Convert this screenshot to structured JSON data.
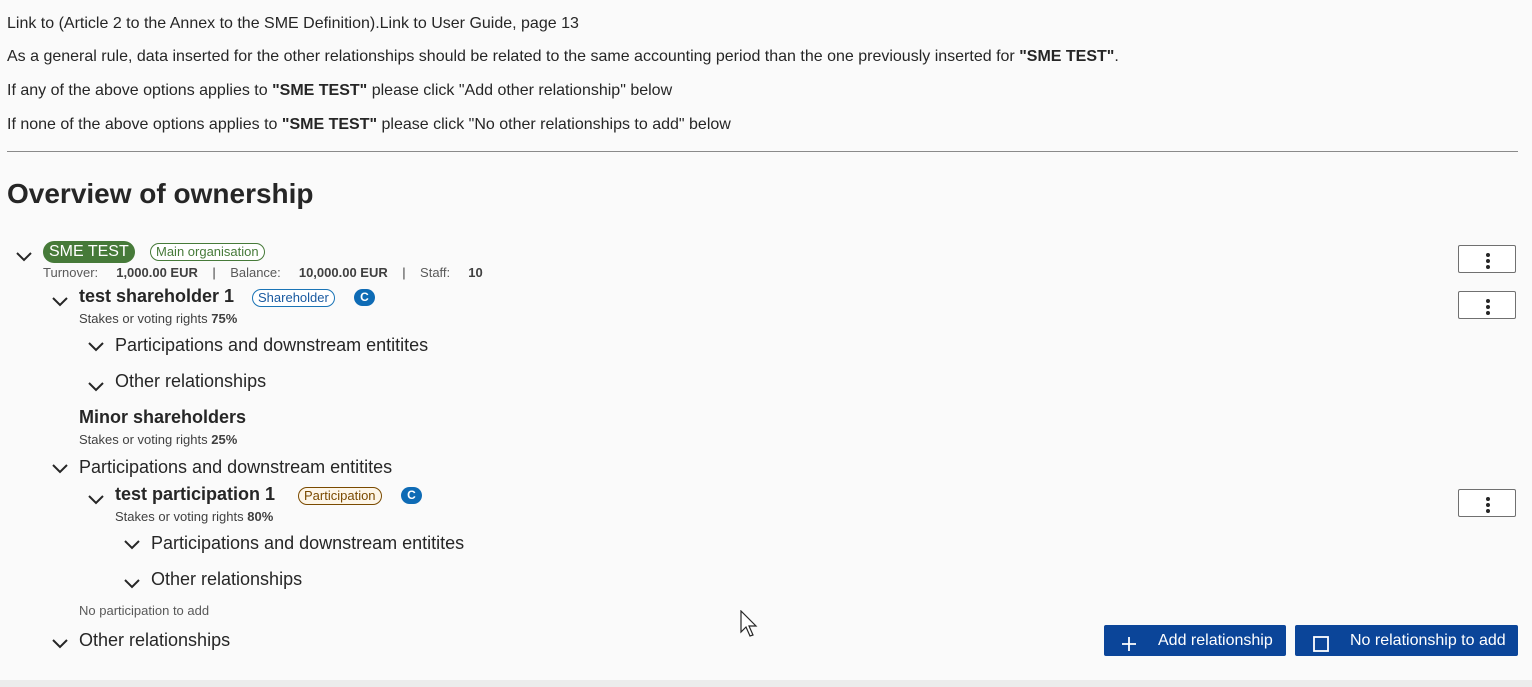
{
  "intro": {
    "line1": "Link to (Article 2 to the Annex to the SME Definition).Link to User Guide, page 13",
    "line2_pre": "As a general rule, data inserted for the other relationships should be related to the same accounting period than the one previously inserted for ",
    "line2_bold": "\"SME TEST\"",
    "line2_post": ".",
    "line3_pre": "If any of the above options applies to ",
    "line3_bold": "\"SME TEST\"",
    "line3_post": " please click \"Add other relationship\" below",
    "line4_pre": "If none of the above options applies to ",
    "line4_bold": "\"SME TEST\"",
    "line4_post": " please click \"No other relationships to add\" below"
  },
  "heading": "Overview of ownership",
  "main_org": {
    "name": "SME TEST",
    "badge": "Main organisation",
    "turnover_label": "Turnover:",
    "turnover_value": "1,000.00 EUR",
    "balance_label": "Balance:",
    "balance_value": "10,000.00 EUR",
    "staff_label": "Staff:",
    "staff_value": "10",
    "sep": "|"
  },
  "shareholder": {
    "name": "test shareholder 1",
    "badge": "Shareholder",
    "c_badge": "C",
    "stakes_label": "Stakes or voting rights",
    "stakes_value": "75%",
    "sub1": "Participations and downstream entitites",
    "sub2": "Other relationships"
  },
  "minor": {
    "name": "Minor shareholders",
    "stakes_label": "Stakes or voting rights",
    "stakes_value": "25%"
  },
  "participations": {
    "label": "Participations and downstream entitites",
    "item": {
      "name": "test participation 1",
      "badge": "Participation",
      "c_badge": "C",
      "stakes_label": "Stakes or voting rights",
      "stakes_value": "80%",
      "sub1": "Participations and downstream entitites",
      "sub2": "Other relationships"
    },
    "empty_note": "No participation to add"
  },
  "other_relationships": "Other relationships",
  "buttons": {
    "add": "Add relationship",
    "none": "No relationship to add"
  },
  "colors": {
    "primary": "#0b4599",
    "green": "#467a39",
    "c_badge": "#0e6bb5"
  }
}
